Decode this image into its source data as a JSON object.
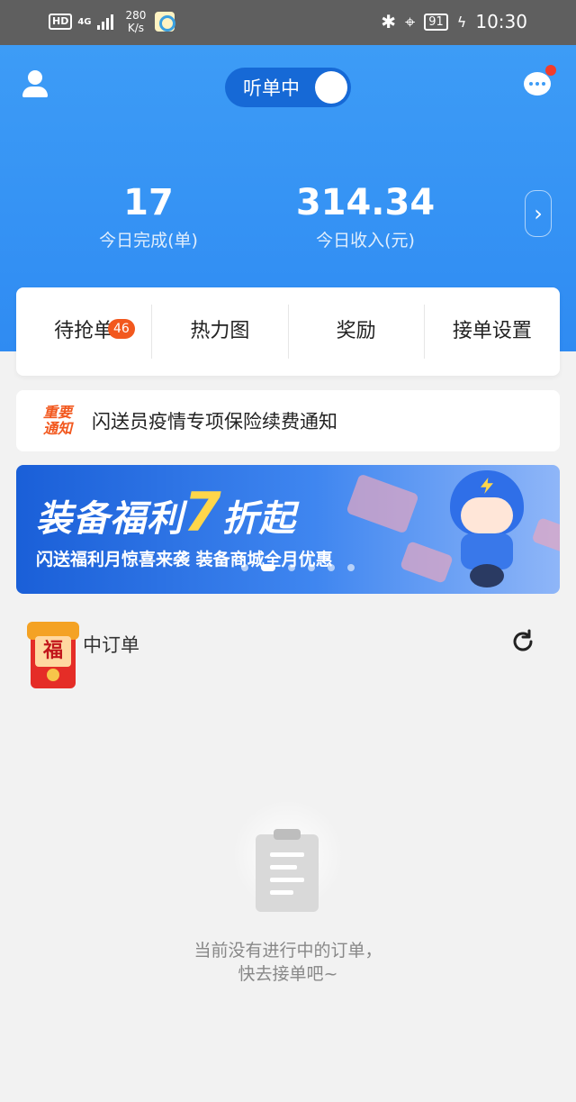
{
  "status_bar": {
    "hd": "HD",
    "network": "4G",
    "speed_value": "280",
    "speed_unit": "K/s",
    "battery": "91",
    "time": "10:30"
  },
  "header": {
    "toggle_label": "听单中",
    "stats": [
      {
        "value": "17",
        "label": "今日完成(单)"
      },
      {
        "value": "314.34",
        "label": "今日收入(元)"
      }
    ]
  },
  "tabs": [
    {
      "label": "待抢单",
      "badge": "46"
    },
    {
      "label": "热力图"
    },
    {
      "label": "奖励"
    },
    {
      "label": "接单设置"
    }
  ],
  "notice": {
    "tag_line1": "重要",
    "tag_line2": "通知",
    "text": "闪送员疫情专项保险续费通知"
  },
  "banner": {
    "title_part1": "装备福利",
    "title_number": "7",
    "title_part2": "折起",
    "subtitle": "闪送福利月惊喜来袭 装备商城全月优惠",
    "dot_count": 6,
    "active_dot": 1
  },
  "orders": {
    "title": "中订单",
    "redpacket_char": "福",
    "empty_line1": "当前没有进行中的订单，",
    "empty_line2": "快去接单吧~"
  },
  "colors": {
    "primary": "#3d9cf6",
    "toggle_bg": "#1669d6",
    "badge": "#f2581e",
    "notice_tag": "#f2581e",
    "banner_accent": "#ffd64a"
  }
}
